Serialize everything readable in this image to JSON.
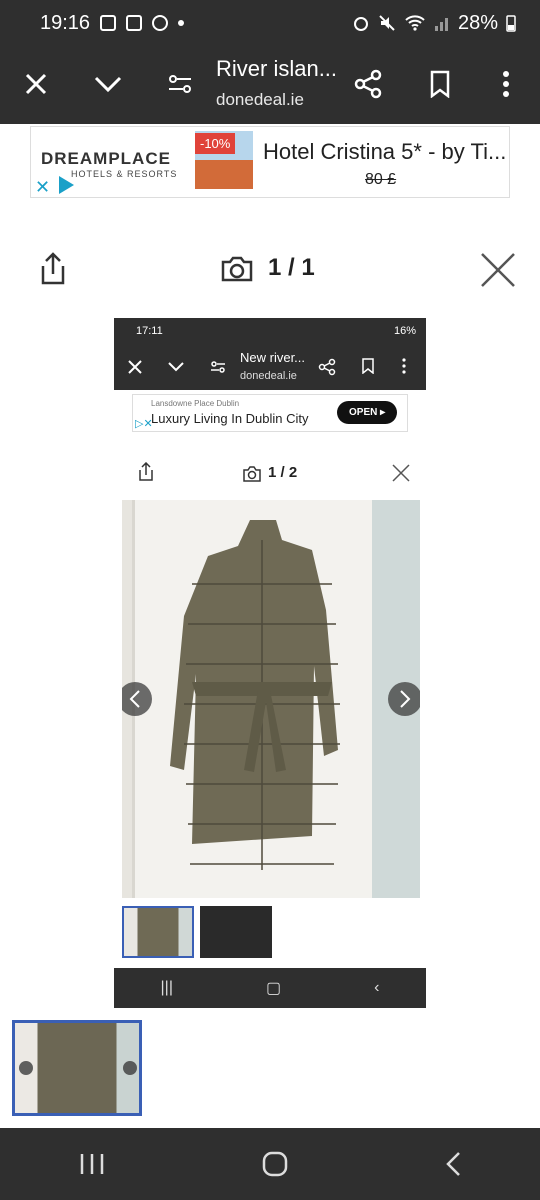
{
  "status_bar": {
    "time": "19:16",
    "battery": "28%"
  },
  "top_bar": {
    "title": "River islan...",
    "subtitle": "donedeal.ie"
  },
  "ad": {
    "brand": "DREAMPLACE",
    "brand_sub": "HOTELS & RESORTS",
    "badge": "-10%",
    "title": "Hotel Cristina 5* - by Ti...",
    "price": "80 £"
  },
  "viewer": {
    "counter": "1 / 1"
  },
  "screenshot": {
    "status_time": "17:11",
    "battery": "16%",
    "title": "New river...",
    "subtitle": "donedeal.ie",
    "ad_small": "Lansdowne Place Dublin",
    "ad_big": "Luxury Living In Dublin City",
    "ad_button": "OPEN",
    "counter": "1 / 2"
  },
  "colors": {
    "dark_bar": "#2f2f2f",
    "accent_blue": "#3a5fb5",
    "ad_badge": "#e0433a",
    "coat": "#6f6a55"
  }
}
